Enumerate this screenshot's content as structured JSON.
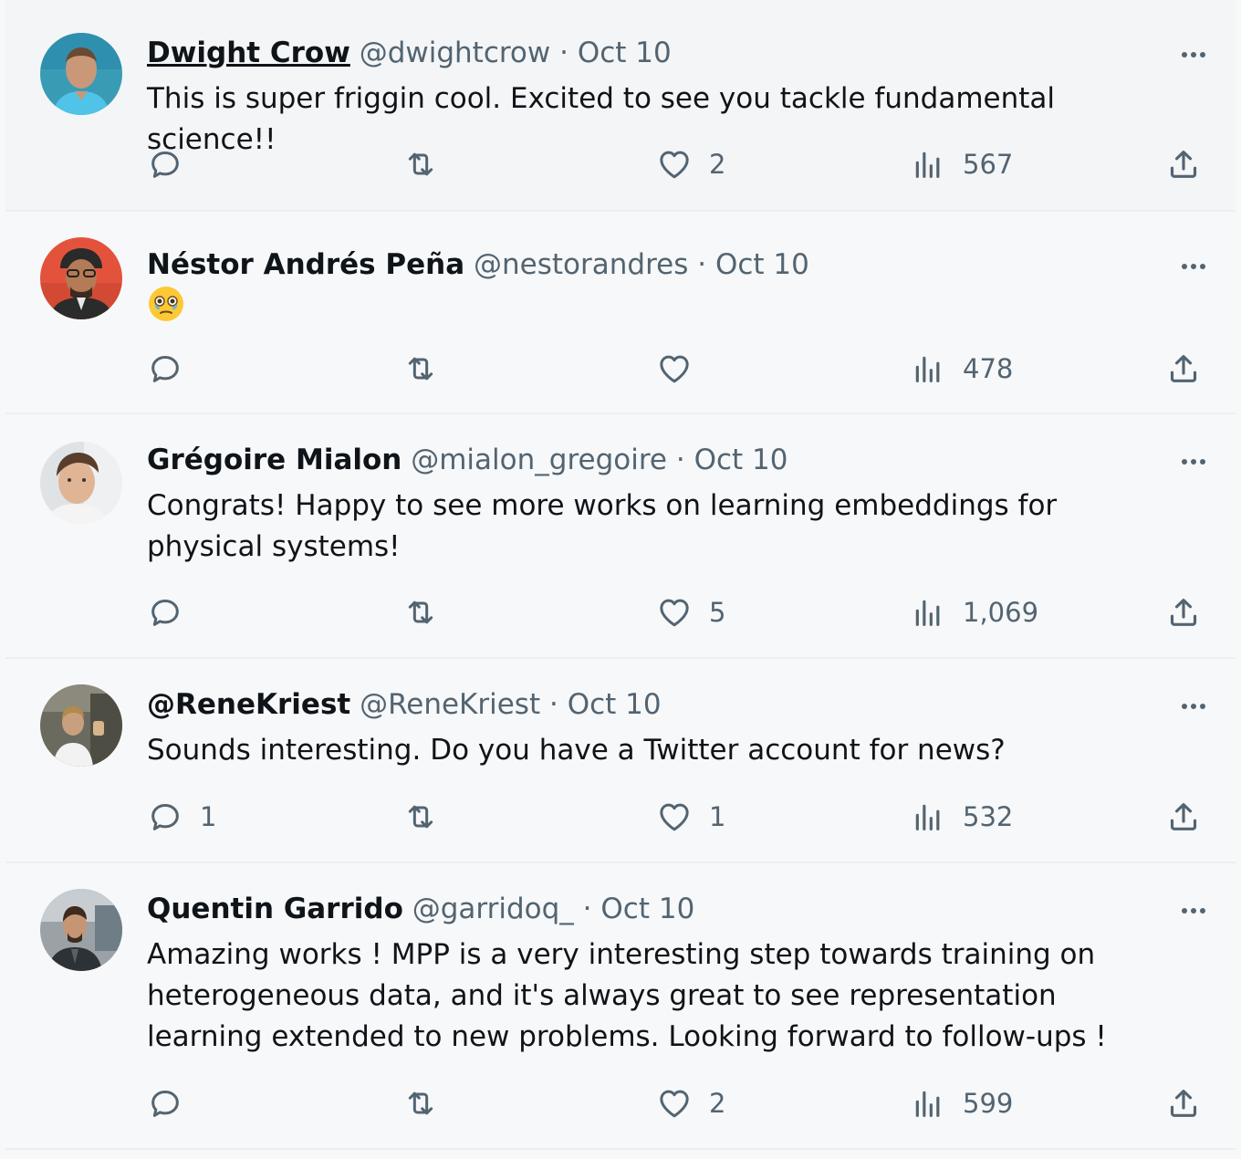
{
  "tweets": [
    {
      "name": "Dwight Crow",
      "handle": "@dwightcrow",
      "separator": "·",
      "date": "Oct 10",
      "text": "This is super friggin cool. Excited to see you tackle fundamental science!!",
      "replies": "",
      "retweets": "",
      "likes": "2",
      "views": "567"
    },
    {
      "name": "Néstor Andrés Peña",
      "handle": "@nestorandres",
      "separator": "·",
      "date": "Oct 10",
      "text": "",
      "emoji": "holding-back-tears-emoji",
      "replies": "",
      "retweets": "",
      "likes": "",
      "views": "478"
    },
    {
      "name": "Grégoire Mialon",
      "handle": "@mialon_gregoire",
      "separator": "·",
      "date": "Oct 10",
      "text": "Congrats! Happy to see more works on learning embeddings for physical systems!",
      "replies": "",
      "retweets": "",
      "likes": "5",
      "views": "1,069"
    },
    {
      "name": "@ReneKriest",
      "handle": "@ReneKriest",
      "separator": "·",
      "date": "Oct 10",
      "text": "Sounds interesting. Do you have a Twitter account for news?",
      "replies": "1",
      "retweets": "",
      "likes": "1",
      "views": "532"
    },
    {
      "name": "Quentin Garrido",
      "handle": "@garridoq_",
      "separator": "·",
      "date": "Oct 10",
      "text": "Amazing works ! MPP is a very interesting step towards training on heterogeneous data, and it's always great to see representation learning extended to new problems. Looking forward to follow-ups !",
      "replies": "",
      "retweets": "",
      "likes": "2",
      "views": "599"
    }
  ],
  "icons": {
    "reply": "reply-icon",
    "retweet": "retweet-icon",
    "like": "heart-icon",
    "views": "views-icon",
    "share": "share-icon",
    "more": "more-icon"
  },
  "colors": {
    "text": "#0f1419",
    "muted": "#536471",
    "background": "#f7f8f9"
  }
}
